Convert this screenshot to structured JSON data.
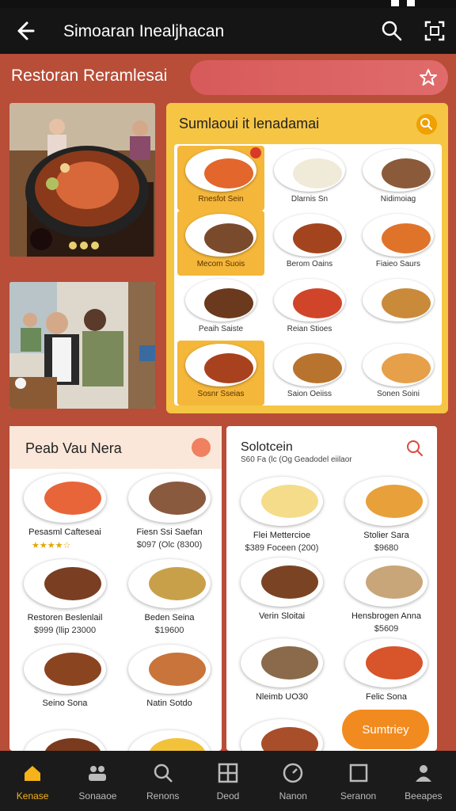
{
  "app": {
    "title": "Simoaran Inealjhacan"
  },
  "header": {
    "section_title": "Restoran Reramlesai",
    "search_placeholder": ""
  },
  "featured": {
    "title": "Sumlaoui it lenadamai",
    "items": [
      {
        "name": "Rnesfot Sein",
        "highlight": true,
        "favorite": true,
        "color": "#e3662c"
      },
      {
        "name": "Dlarnis Sn",
        "highlight": false,
        "color": "#f0ead8"
      },
      {
        "name": "Nidimoiag",
        "highlight": false,
        "color": "#8a5a3a"
      },
      {
        "name": "Mecom Suois",
        "highlight": true,
        "color": "#7a4a2c"
      },
      {
        "name": "Berom Oains",
        "highlight": false,
        "color": "#a3441e"
      },
      {
        "name": "Fiaieo Saurs",
        "highlight": false,
        "color": "#e0732a"
      },
      {
        "name": "Peaih Saiste",
        "highlight": false,
        "color": "#6b3a1e"
      },
      {
        "name": "Reian Stioes",
        "highlight": false,
        "color": "#d0452a"
      },
      {
        "name": "",
        "highlight": false,
        "color": "#c98a3a"
      },
      {
        "name": "Sosnr Sseias",
        "highlight": true,
        "color": "#a8421e"
      },
      {
        "name": "Saion Oeiiss",
        "highlight": false,
        "color": "#b8742e"
      },
      {
        "name": "Sonen Soini",
        "highlight": false,
        "color": "#e6a04a"
      }
    ]
  },
  "menu_left": {
    "title": "Peab Vau Nera",
    "items": [
      {
        "name": "Pesasml Cafteseai",
        "price": "",
        "stars": "★★★★☆",
        "color": "#e8653a"
      },
      {
        "name": "Fiesn Ssi Saefan",
        "price": "$097 (Olc (8300)",
        "color": "#8a5a3e"
      },
      {
        "name": "Restoren Beslenlail",
        "price": "$999 (llip 23000",
        "color": "#7a3e22"
      },
      {
        "name": "Beden Seina",
        "price": "$19600",
        "color": "#c9a04a"
      },
      {
        "name": "Seino Sona",
        "price": "",
        "color": "#8a4420"
      },
      {
        "name": "Natin Sotdo",
        "price": "",
        "color": "#c8743a"
      },
      {
        "name": "",
        "price": "",
        "color": "#7a3a1e"
      },
      {
        "name": "",
        "price": "",
        "color": "#f2c23a"
      }
    ]
  },
  "menu_right": {
    "title": "Solotcein",
    "subtitle": "S60 Fa (lc (Og Geadodel eiilaor",
    "items": [
      {
        "name": "Flei Mettercioe",
        "price": "$389 Foceen (200)",
        "color": "#f4dc8a"
      },
      {
        "name": "Stolier Sara",
        "price": "$9680",
        "color": "#e8a03a"
      },
      {
        "name": "Verin Sloitai",
        "price": "",
        "color": "#7a4424"
      },
      {
        "name": "Hensbrogen Anna",
        "price": "$5609",
        "color": "#c8a67a"
      },
      {
        "name": "Nleimb UO30",
        "price": "",
        "color": "#8a6a4a"
      },
      {
        "name": "Felic Sona",
        "price": "",
        "color": "#d8542a"
      },
      {
        "name": "",
        "price": "",
        "color": "#a84e2a"
      }
    ],
    "cta_label": "Sumtriey"
  },
  "nav": [
    {
      "label": "Kenase",
      "icon": "home-icon",
      "active": true
    },
    {
      "label": "Sonaaoe",
      "icon": "people-icon",
      "active": false
    },
    {
      "label": "Renons",
      "icon": "search-icon",
      "active": false
    },
    {
      "label": "Deod",
      "icon": "grid-icon",
      "active": false
    },
    {
      "label": "Nanon",
      "icon": "clock-icon",
      "active": false
    },
    {
      "label": "Seranon",
      "icon": "square-icon",
      "active": false
    },
    {
      "label": "Beeapes",
      "icon": "person-icon",
      "active": false
    }
  ],
  "colors": {
    "background": "#b84d38",
    "appbar": "#151515",
    "accent": "#f6b21a",
    "featured_panel": "#f6c544",
    "cta": "#f28b1f"
  }
}
